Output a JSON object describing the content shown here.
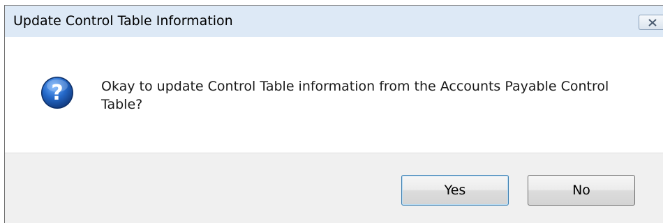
{
  "dialog": {
    "title": "Update Control Table Information",
    "message": "Okay to update Control Table information from the Accounts Payable Control Table?",
    "icon": "question-icon",
    "buttons": {
      "yes_label": "Yes",
      "no_label": "No"
    },
    "close_icon": "close-icon",
    "colors": {
      "titlebar": "#dde9f6",
      "footer": "#f0f0f0",
      "icon_blue": "#1f5fb5"
    }
  }
}
